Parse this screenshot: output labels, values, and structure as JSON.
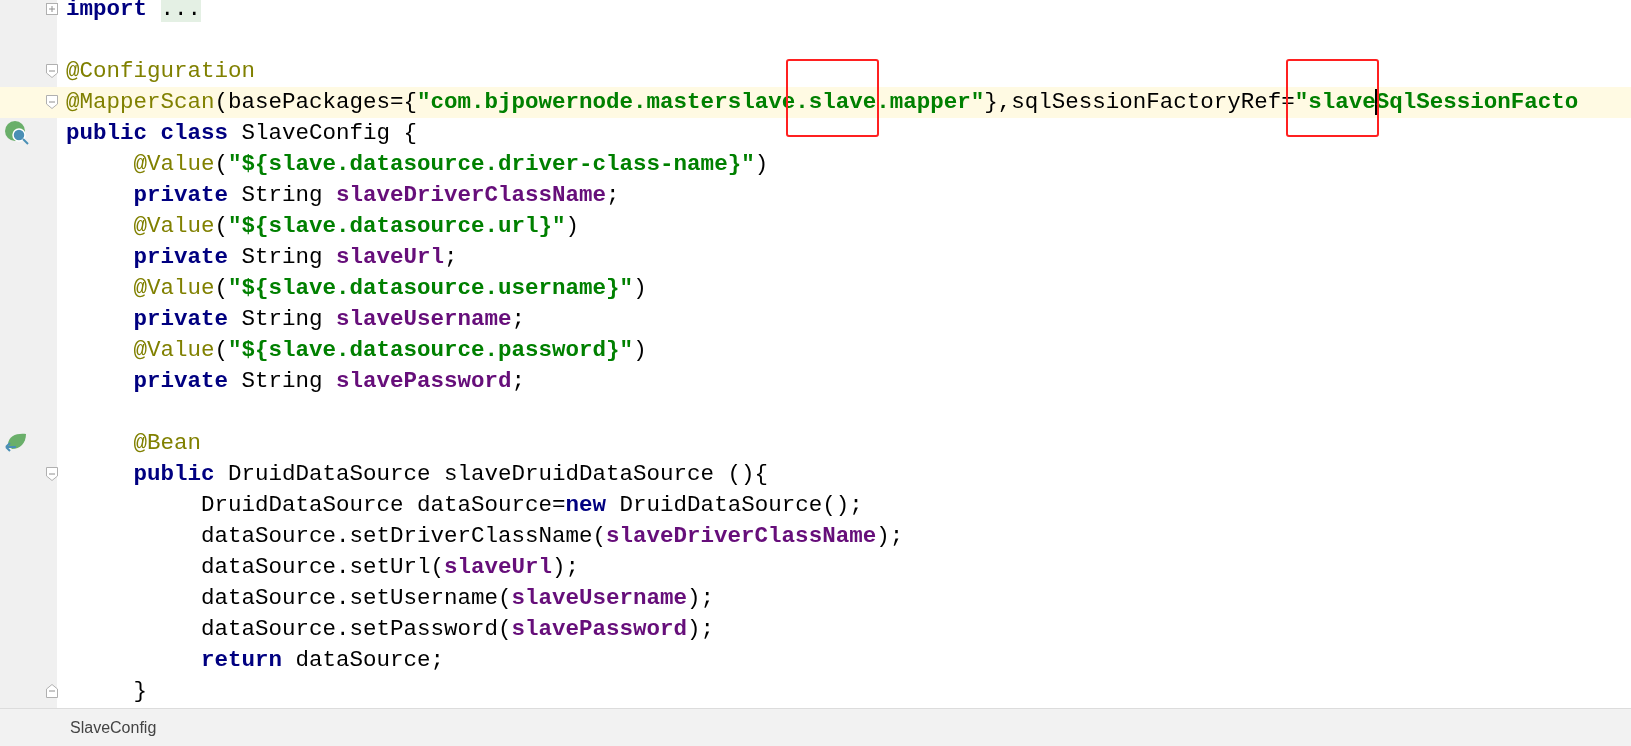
{
  "editor": {
    "blocks": [
      {
        "lines": [
          {
            "fold": {
              "kind": "collapsed"
            },
            "tokens": [
              {
                "kind": "keyword",
                "text": "import "
              },
              {
                "kind": "folded",
                "text": "..."
              }
            ]
          }
        ]
      },
      {
        "lines": [
          {
            "fold": {
              "kind": "start"
            },
            "tokens": [
              {
                "kind": "annotation",
                "text": "@Configuration"
              }
            ]
          },
          {
            "fold": {
              "kind": "start"
            },
            "highlighted": true,
            "tokens": [
              {
                "kind": "annotation",
                "text": "@MapperScan"
              },
              {
                "kind": "plain",
                "text": "(basePackages={"
              },
              {
                "kind": "string",
                "text": "\"com.bjpowernode.masterslave"
              },
              {
                "kind": "string",
                "text": ".slave",
                "boxed": true
              },
              {
                "kind": "string",
                "text": ".mapper\""
              },
              {
                "kind": "plain",
                "text": "},sqlSessionFactoryRef="
              },
              {
                "kind": "string",
                "text": "\"slave",
                "boxed": true
              },
              {
                "kind": "caret"
              },
              {
                "kind": "string",
                "text": "SqlSessionFacto"
              }
            ]
          },
          {
            "gutter_icon": {
              "kind": "class"
            },
            "tokens": [
              {
                "kind": "keyword",
                "text": "public class"
              },
              {
                "kind": "plain",
                "text": " SlaveConfig {"
              }
            ]
          },
          {
            "tokens": [
              {
                "kind": "annotation",
                "text": "     @Value"
              },
              {
                "kind": "plain",
                "text": "("
              },
              {
                "kind": "string",
                "text": "\"${slave.datasource.driver-class-name}\""
              },
              {
                "kind": "plain",
                "text": ")"
              }
            ]
          },
          {
            "tokens": [
              {
                "kind": "keyword",
                "text": "     private"
              },
              {
                "kind": "plain",
                "text": " String "
              },
              {
                "kind": "field",
                "text": "slaveDriverClassName"
              },
              {
                "kind": "plain",
                "text": ";"
              }
            ]
          },
          {
            "tokens": [
              {
                "kind": "annotation",
                "text": "     @Value"
              },
              {
                "kind": "plain",
                "text": "("
              },
              {
                "kind": "string",
                "text": "\"${slave.datasource.url}\""
              },
              {
                "kind": "plain",
                "text": ")"
              }
            ]
          },
          {
            "tokens": [
              {
                "kind": "keyword",
                "text": "     private"
              },
              {
                "kind": "plain",
                "text": " String "
              },
              {
                "kind": "field",
                "text": "slaveUrl"
              },
              {
                "kind": "plain",
                "text": ";"
              }
            ]
          },
          {
            "tokens": [
              {
                "kind": "annotation",
                "text": "     @Value"
              },
              {
                "kind": "plain",
                "text": "("
              },
              {
                "kind": "string",
                "text": "\"${slave.datasource.username}\""
              },
              {
                "kind": "plain",
                "text": ")"
              }
            ]
          },
          {
            "tokens": [
              {
                "kind": "keyword",
                "text": "     private"
              },
              {
                "kind": "plain",
                "text": " String "
              },
              {
                "kind": "field",
                "text": "slaveUsername"
              },
              {
                "kind": "plain",
                "text": ";"
              }
            ]
          },
          {
            "tokens": [
              {
                "kind": "annotation",
                "text": "     @Value"
              },
              {
                "kind": "plain",
                "text": "("
              },
              {
                "kind": "string",
                "text": "\"${slave.datasource.password}\""
              },
              {
                "kind": "plain",
                "text": ")"
              }
            ]
          },
          {
            "tokens": [
              {
                "kind": "keyword",
                "text": "     private"
              },
              {
                "kind": "plain",
                "text": " String "
              },
              {
                "kind": "field",
                "text": "slavePassword"
              },
              {
                "kind": "plain",
                "text": ";"
              }
            ]
          }
        ]
      },
      {
        "lines": [
          {
            "gutter_icon": {
              "kind": "method"
            },
            "tokens": [
              {
                "kind": "annotation",
                "text": "     @Bean"
              }
            ]
          },
          {
            "fold": {
              "kind": "start"
            },
            "tokens": [
              {
                "kind": "keyword",
                "text": "     public"
              },
              {
                "kind": "plain",
                "text": " DruidDataSource slaveDruidDataSource (){"
              }
            ]
          },
          {
            "tokens": [
              {
                "kind": "plain",
                "text": "          DruidDataSource dataSource="
              },
              {
                "kind": "keyword",
                "text": "new"
              },
              {
                "kind": "plain",
                "text": " DruidDataSource();"
              }
            ]
          },
          {
            "tokens": [
              {
                "kind": "plain",
                "text": "          dataSource.setDriverClassName("
              },
              {
                "kind": "field",
                "text": "slaveDriverClassName"
              },
              {
                "kind": "plain",
                "text": ");"
              }
            ]
          },
          {
            "tokens": [
              {
                "kind": "plain",
                "text": "          dataSource.setUrl("
              },
              {
                "kind": "field",
                "text": "slaveUrl"
              },
              {
                "kind": "plain",
                "text": ");"
              }
            ]
          },
          {
            "tokens": [
              {
                "kind": "plain",
                "text": "          dataSource.setUsername("
              },
              {
                "kind": "field",
                "text": "slaveUsername"
              },
              {
                "kind": "plain",
                "text": ");"
              }
            ]
          },
          {
            "tokens": [
              {
                "kind": "plain",
                "text": "          dataSource.setPassword("
              },
              {
                "kind": "field",
                "text": "slavePassword"
              },
              {
                "kind": "plain",
                "text": ");"
              }
            ]
          },
          {
            "tokens": [
              {
                "kind": "keyword",
                "text": "          return"
              },
              {
                "kind": "plain",
                "text": " dataSource;"
              }
            ]
          },
          {
            "fold": {
              "kind": "end"
            },
            "tokens": [
              {
                "kind": "plain",
                "text": "     }"
              }
            ]
          }
        ]
      }
    ]
  },
  "breadcrumb": "SlaveConfig"
}
